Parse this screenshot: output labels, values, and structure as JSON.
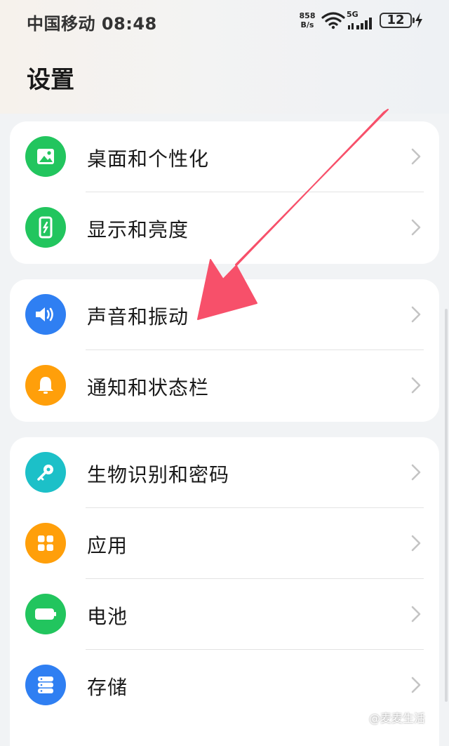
{
  "status_bar": {
    "carrier_time": "中国移动 08:48",
    "net_speed_value": "858",
    "net_speed_unit": "B/s",
    "network_type": "5G",
    "battery_level": "12"
  },
  "header": {
    "title": "设置"
  },
  "groups": [
    {
      "items": [
        {
          "label": "桌面和个性化",
          "icon": "image-icon",
          "color": "#22c55e"
        },
        {
          "label": "显示和亮度",
          "icon": "phone-brightness-icon",
          "color": "#22c55e"
        }
      ]
    },
    {
      "items": [
        {
          "label": "声音和振动",
          "icon": "speaker-icon",
          "color": "#2f7ff2"
        },
        {
          "label": "通知和状态栏",
          "icon": "bell-icon",
          "color": "#ff9f0a"
        }
      ]
    },
    {
      "items": [
        {
          "label": "生物识别和密码",
          "icon": "key-icon",
          "color": "#1cc0c8"
        },
        {
          "label": "应用",
          "icon": "apps-grid-icon",
          "color": "#ff9f0a"
        },
        {
          "label": "电池",
          "icon": "battery-icon",
          "color": "#22c55e"
        },
        {
          "label": "存储",
          "icon": "storage-icon",
          "color": "#2f7ff2"
        }
      ]
    }
  ],
  "annotation": {
    "arrow_color": "#f7506a"
  },
  "watermark": "@麦麦生活"
}
